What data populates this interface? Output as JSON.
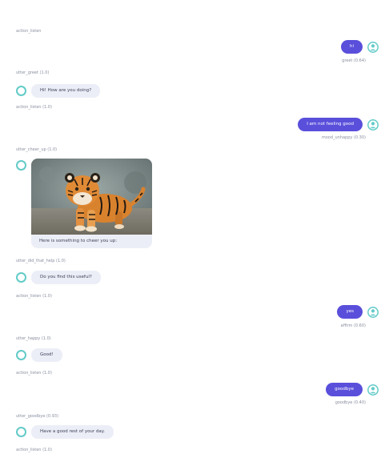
{
  "messages": {
    "a1": "action_listen",
    "u1": {
      "text": "hi",
      "intent": "greet (0.64)"
    },
    "a2": "utter_greet (1.0)",
    "b2": "Hi! How are you doing?",
    "a3": "action_listen (1.0)",
    "u3": {
      "text": "I am not feeling good",
      "intent": "mood_unhappy (0.30)"
    },
    "a4": "utter_cheer_up (1.0)",
    "b4": "Here is something to cheer you up:",
    "a5": "utter_did_that_help (1.0)",
    "b5": "Do you find this useful?",
    "a6": "action_listen (1.0)",
    "u6": {
      "text": "yes",
      "intent": "affirm (0.60)"
    },
    "a7": "utter_happy (1.0)",
    "b7": "Good!",
    "a8": "action_listen (1.0)",
    "u8": {
      "text": "goodbye",
      "intent": "goodbye (0.40)"
    },
    "a9": "utter_goodbye (0.93)",
    "b9": "Have a good rest of your day.",
    "a10": "action_listen (1.0)"
  },
  "icons": {
    "bot_avatar": "bot-avatar-ring",
    "user_avatar": "user-avatar-icon",
    "cheer_up_image": "tiger-cub-photo"
  },
  "colors": {
    "user_bubble": "#5a4fdb",
    "bot_bubble": "#eceef7",
    "avatar_teal": "#62cbc8"
  }
}
